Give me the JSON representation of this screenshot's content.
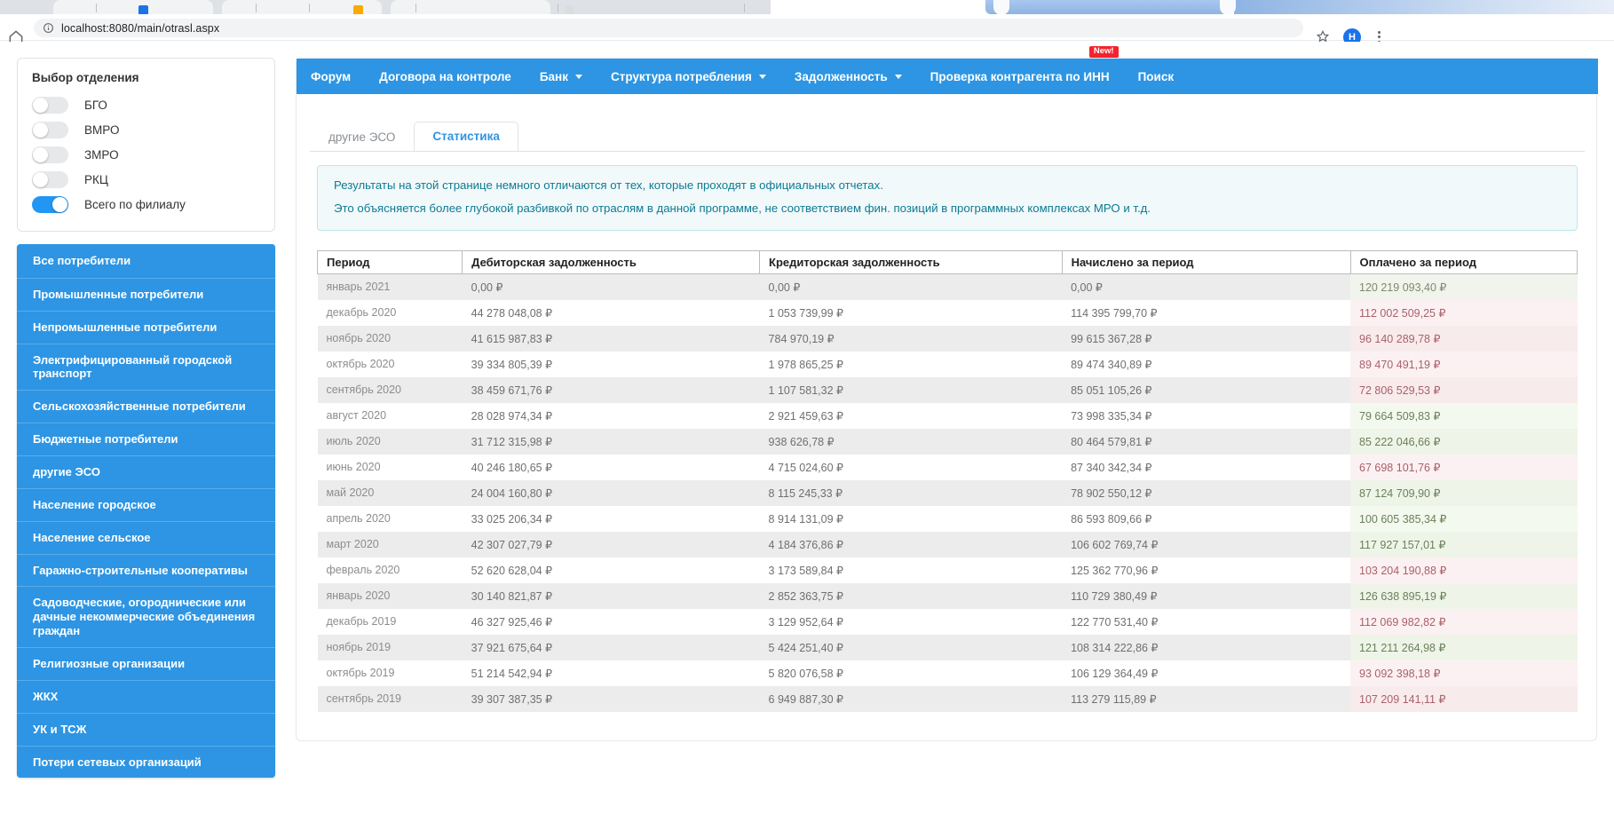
{
  "browser": {
    "url": "localhost:8080/main/otrasl.aspx",
    "avatar_letter": "H",
    "home_icon": "home-icon",
    "info_icon": "info-circle-icon",
    "star_icon": "star-icon",
    "menu_icon": "kebab-menu-icon"
  },
  "branch_card": {
    "title": "Выбор отделения",
    "options": [
      {
        "label": "БГО",
        "on": false
      },
      {
        "label": "ВМРО",
        "on": false
      },
      {
        "label": "ЗМРО",
        "on": false
      },
      {
        "label": "РКЦ",
        "on": false
      },
      {
        "label": "Всего по филиалу",
        "on": true
      }
    ]
  },
  "categories": [
    "Все потребители",
    "Промышленные потребители",
    "Непромышленные потребители",
    "Электрифицированный городской транспорт",
    "Сельскохозяйственные потребители",
    "Бюджетные потребители",
    "другие ЭСО",
    "Население городское",
    "Население сельское",
    "Гаражно-строительные кооперативы",
    "Садоводческие, огороднические или дачные некоммерческие объединения граждан",
    "Религиозные организации",
    "ЖКХ",
    "УК и ТСЖ",
    "Потери сетевых организаций"
  ],
  "navbar": [
    {
      "label": "Форум",
      "caret": false,
      "badge": null
    },
    {
      "label": "Договора на контроле",
      "caret": false,
      "badge": null
    },
    {
      "label": "Банк",
      "caret": true,
      "badge": null
    },
    {
      "label": "Структура потребления",
      "caret": true,
      "badge": null
    },
    {
      "label": "Задолженность",
      "caret": true,
      "badge": null
    },
    {
      "label": "Проверка контрагента по ИНН",
      "caret": false,
      "badge": "New!"
    },
    {
      "label": "Поиск",
      "caret": false,
      "badge": null
    }
  ],
  "tabs": [
    {
      "label": "другие ЭСО",
      "active": false
    },
    {
      "label": "Статистика",
      "active": true
    }
  ],
  "notice": {
    "line1": "Результаты на этой странице немного отличаются от тех, которые проходят в официальных отчетах.",
    "line2": "Это объясняется более глубокой разбивкой по отраслям в данной программе, не соответствием фин. позиций в программных комплексах МРО и т.д."
  },
  "table": {
    "columns": [
      "Период",
      "Дебиторская задолженность",
      "Кредиторская задолженность",
      "Начислено за период",
      "Оплачено за период"
    ],
    "rows": [
      {
        "period": "январь 2021",
        "debit": "0,00 ₽",
        "credit": "0,00 ₽",
        "accrued": "0,00 ₽",
        "paid": "120 219 093,40 ₽",
        "paid_state": "zero"
      },
      {
        "period": "декабрь 2020",
        "debit": "44 278 048,08 ₽",
        "credit": "1 053 739,99 ₽",
        "accrued": "114 395 799,70 ₽",
        "paid": "112 002 509,25 ₽",
        "paid_state": "down"
      },
      {
        "period": "ноябрь 2020",
        "debit": "41 615 987,83 ₽",
        "credit": "784 970,19 ₽",
        "accrued": "99 615 367,28 ₽",
        "paid": "96 140 289,78 ₽",
        "paid_state": "down"
      },
      {
        "period": "октябрь 2020",
        "debit": "39 334 805,39 ₽",
        "credit": "1 978 865,25 ₽",
        "accrued": "89 474 340,89 ₽",
        "paid": "89 470 491,19 ₽",
        "paid_state": "down"
      },
      {
        "period": "сентябрь 2020",
        "debit": "38 459 671,76 ₽",
        "credit": "1 107 581,32 ₽",
        "accrued": "85 051 105,26 ₽",
        "paid": "72 806 529,53 ₽",
        "paid_state": "down"
      },
      {
        "period": "август 2020",
        "debit": "28 028 974,34 ₽",
        "credit": "2 921 459,63 ₽",
        "accrued": "73 998 335,34 ₽",
        "paid": "79 664 509,83 ₽",
        "paid_state": "up"
      },
      {
        "period": "июль 2020",
        "debit": "31 712 315,98 ₽",
        "credit": "938 626,78 ₽",
        "accrued": "80 464 579,81 ₽",
        "paid": "85 222 046,66 ₽",
        "paid_state": "up"
      },
      {
        "period": "июнь 2020",
        "debit": "40 246 180,65 ₽",
        "credit": "4 715 024,60 ₽",
        "accrued": "87 340 342,34 ₽",
        "paid": "67 698 101,76 ₽",
        "paid_state": "down"
      },
      {
        "period": "май 2020",
        "debit": "24 004 160,80 ₽",
        "credit": "8 115 245,33 ₽",
        "accrued": "78 902 550,12 ₽",
        "paid": "87 124 709,90 ₽",
        "paid_state": "up"
      },
      {
        "period": "апрель 2020",
        "debit": "33 025 206,34 ₽",
        "credit": "8 914 131,09 ₽",
        "accrued": "86 593 809,66 ₽",
        "paid": "100 605 385,34 ₽",
        "paid_state": "up"
      },
      {
        "period": "март 2020",
        "debit": "42 307 027,79 ₽",
        "credit": "4 184 376,86 ₽",
        "accrued": "106 602 769,74 ₽",
        "paid": "117 927 157,01 ₽",
        "paid_state": "up"
      },
      {
        "period": "февраль 2020",
        "debit": "52 620 628,04 ₽",
        "credit": "3 173 589,84 ₽",
        "accrued": "125 362 770,96 ₽",
        "paid": "103 204 190,88 ₽",
        "paid_state": "down"
      },
      {
        "period": "январь 2020",
        "debit": "30 140 821,87 ₽",
        "credit": "2 852 363,75 ₽",
        "accrued": "110 729 380,49 ₽",
        "paid": "126 638 895,19 ₽",
        "paid_state": "up"
      },
      {
        "period": "декабрь 2019",
        "debit": "46 327 925,46 ₽",
        "credit": "3 129 952,64 ₽",
        "accrued": "122 770 531,40 ₽",
        "paid": "112 069 982,82 ₽",
        "paid_state": "down"
      },
      {
        "period": "ноябрь 2019",
        "debit": "37 921 675,64 ₽",
        "credit": "5 424 251,40 ₽",
        "accrued": "108 314 222,86 ₽",
        "paid": "121 211 264,98 ₽",
        "paid_state": "up"
      },
      {
        "period": "октябрь 2019",
        "debit": "51 214 542,94 ₽",
        "credit": "5 820 076,58 ₽",
        "accrued": "106 129 364,49 ₽",
        "paid": "93 092 398,18 ₽",
        "paid_state": "down"
      },
      {
        "period": "сентябрь 2019",
        "debit": "39 307 387,35 ₽",
        "credit": "6 949 887,30 ₽",
        "accrued": "113 279 115,89 ₽",
        "paid": "107 209 141,11 ₽",
        "paid_state": "down"
      }
    ]
  },
  "colors": {
    "brand_blue": "#2d95e3",
    "notice_text": "#0c7b92",
    "badge_red": "#f5222d"
  }
}
